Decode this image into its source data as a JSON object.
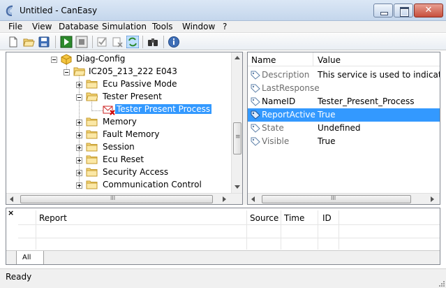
{
  "window": {
    "title": "Untitled - CanEasy",
    "close_glyph": "✕"
  },
  "menu": [
    "File",
    "View",
    "Database",
    "Simulation",
    "Tools",
    "Window",
    "?"
  ],
  "toolbar_icons": [
    "new-file-icon",
    "open-folder-icon",
    "save-icon",
    "run-icon",
    "stop-icon",
    "check-icon",
    "clear-check-icon",
    "refresh-icon",
    "binoculars-icon",
    "info-icon"
  ],
  "tree": {
    "nodes": [
      {
        "label": "Diag-Config",
        "icon": "cube-icon"
      },
      {
        "label": "IC205_213_222 E043",
        "icon": "folder-icon"
      },
      {
        "label": "Ecu Passive Mode",
        "icon": "folder-icon"
      },
      {
        "label": "Tester Present",
        "icon": "folder-icon"
      },
      {
        "label": "Tester Present Process",
        "icon": "process-icon",
        "selected": true
      },
      {
        "label": "Memory",
        "icon": "folder-icon"
      },
      {
        "label": "Fault Memory",
        "icon": "folder-icon"
      },
      {
        "label": "Session",
        "icon": "folder-icon"
      },
      {
        "label": "Ecu Reset",
        "icon": "folder-icon"
      },
      {
        "label": "Security Access",
        "icon": "folder-icon"
      },
      {
        "label": "Communication Control",
        "icon": "folder-icon"
      }
    ],
    "hscroll_glyph": "III",
    "vscroll_glyph": "≡"
  },
  "properties": {
    "headers": {
      "name": "Name",
      "value": "Value"
    },
    "rows": [
      {
        "name": "Description",
        "value": "This service is used to indicate to",
        "dim": true
      },
      {
        "name": "LastResponse",
        "value": "",
        "dim": true
      },
      {
        "name": "NameID",
        "value": "Tester_Present_Process",
        "dim": false
      },
      {
        "name": "ReportActive",
        "value": "True",
        "dim": false,
        "selected": true
      },
      {
        "name": "State",
        "value": "Undefined",
        "dim": true
      },
      {
        "name": "Visible",
        "value": "True",
        "dim": true
      }
    ],
    "hscroll_glyph": "III"
  },
  "log": {
    "close_glyph": "×",
    "headers": {
      "report": "Report",
      "source": "Source",
      "time": "Time",
      "id": "ID"
    },
    "tab_label": "All"
  },
  "status": {
    "text": "Ready"
  },
  "colors": {
    "selection": "#3399ff",
    "folder": "#f5d77a",
    "titlebar": "#c4d6ec"
  }
}
